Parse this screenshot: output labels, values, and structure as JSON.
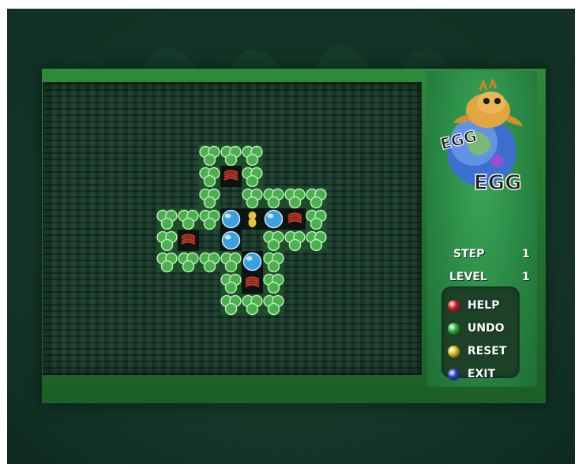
{
  "game": {
    "logo_text_top": "EGG",
    "logo_text_bottom": "EGG"
  },
  "stats": {
    "step_label": "STEP",
    "step_value": "1",
    "level_label": "LEVEL",
    "level_value": "1"
  },
  "menu": {
    "items": [
      {
        "label": "HELP",
        "color": "#d42222"
      },
      {
        "label": "UNDO",
        "color": "#2fb83c"
      },
      {
        "label": "RESET",
        "color": "#e3c21b"
      },
      {
        "label": "EXIT",
        "color": "#2a3fd6"
      }
    ]
  },
  "colors": {
    "wall": "#4caf50",
    "wall_highlight": "#b9f0b9",
    "floor": "#0a1410",
    "egg": "#3aa0e0",
    "target": "#c53828",
    "player": "#e6c23a"
  },
  "level_map": [
    "  ###   ",
    "  #.#   ",
    "  # ####",
    "###o@o.#",
    "#. o ###",
    "####o#  ",
    "   #.#  ",
    "   ###  "
  ]
}
